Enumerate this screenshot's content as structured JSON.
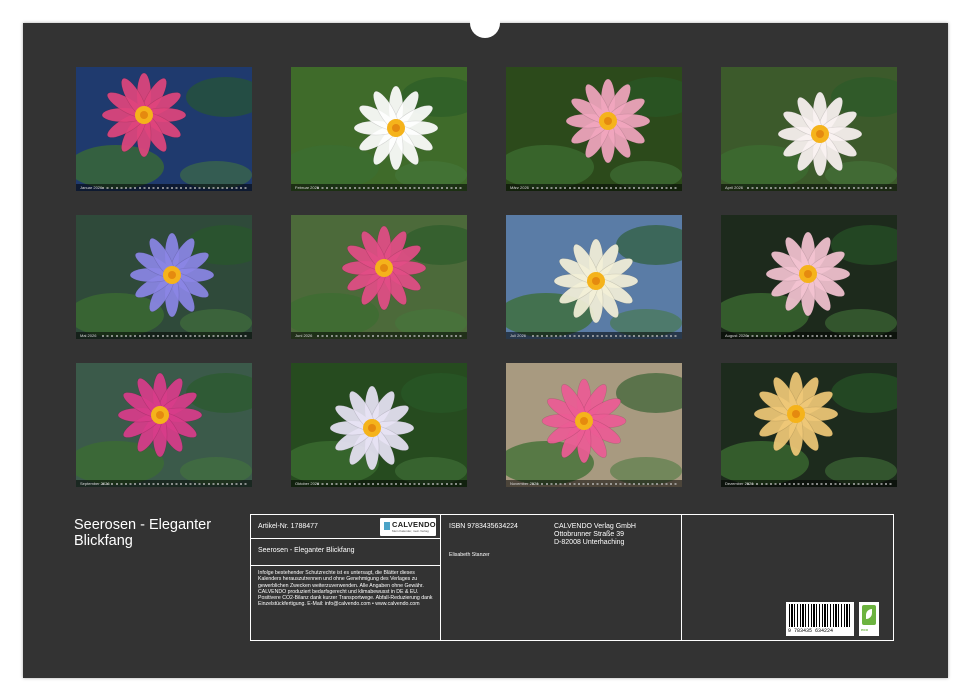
{
  "calendar_title": "Seerosen - Eleganter Blickfang",
  "months": [
    {
      "name": "Januar 2026",
      "flower": "pink water lily cluster",
      "bg": "#1f3a6e",
      "petal": "#e0457d"
    },
    {
      "name": "Februar 2026",
      "flower": "white lily among lily pads",
      "bg": "#3f6b2a",
      "petal": "#ffffff"
    },
    {
      "name": "März 2026",
      "flower": "pink water lily",
      "bg": "#2c4a1b",
      "petal": "#f2a6bf"
    },
    {
      "name": "April 2026",
      "flower": "white water lily with frog",
      "bg": "#3c5a2b",
      "petal": "#fbf3f3"
    },
    {
      "name": "Mai 2026",
      "flower": "violet water lily",
      "bg": "#2f4a3a",
      "petal": "#8b86e6"
    },
    {
      "name": "Juni 2026",
      "flower": "pink water lilies",
      "bg": "#4c6a3a",
      "petal": "#e24d86"
    },
    {
      "name": "Juli 2026",
      "flower": "white bud among reeds",
      "bg": "#5a7ca6",
      "petal": "#f3f0d8"
    },
    {
      "name": "August 2026",
      "flower": "pale pink water lily",
      "bg": "#1d2a1c",
      "petal": "#f4c4d2"
    },
    {
      "name": "September 2026",
      "flower": "magenta water lilies",
      "bg": "#3b5a4a",
      "petal": "#d93c8a"
    },
    {
      "name": "Oktober 2026",
      "flower": "white-violet tropical lily",
      "bg": "#264b1f",
      "petal": "#e8e3f5"
    },
    {
      "name": "November 2026",
      "flower": "pink lily on mud",
      "bg": "#a89a80",
      "petal": "#ec5c95"
    },
    {
      "name": "Dezember 2026",
      "flower": "yellow water lilies",
      "bg": "#1d2b1d",
      "petal": "#f0c978"
    }
  ],
  "info": {
    "article_label": "Artikel-Nr. 1788477",
    "publisher_logo": "CALVENDO",
    "publisher_tagline": "Mein Kalender, mein Verlag",
    "title_line": "Seerosen - Eleganter Blickfang",
    "legal_text": "Infolge bestehender Schutzrechte ist es untersagt, die Blätter dieses Kalenders herauszutrennen und ohne Genehmigung des Verlages zu gewerblichen Zwecken weiterzuverwenden. Alle Angaben ohne Gewähr. CALVENDO produziert bedarfsgerecht und klimabewusst in DE & EU. Positivere CO2-Bilanz dank kurzer Transportwege. Abfall-Reduzierung dank Einzelstückfertigung. E-Mail: info@calvendo.com • www.calvendo.com",
    "isbn": "ISBN 9783435634224",
    "author": "Elisabeth Stanzer",
    "publisher_name": "CALVENDO Verlag GmbH",
    "publisher_street": "Ottobrunner Straße 39",
    "publisher_city": "D-82008 Unterhaching",
    "barcode_digits": "9 783435 634224",
    "eco_label": "eco"
  }
}
